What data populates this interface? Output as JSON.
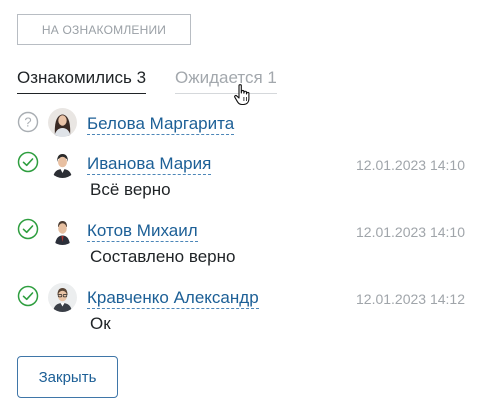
{
  "status_button": {
    "label": "НА ОЗНАКОМЛЕНИИ"
  },
  "tabs": [
    {
      "label": "Ознакомились 3",
      "active": true
    },
    {
      "label": "Ожидается 1",
      "active": false
    }
  ],
  "pending": [
    {
      "name": "Белова Маргарита",
      "status_icon": "question-icon"
    }
  ],
  "acknowledged": [
    {
      "name": "Иванова Мария",
      "time": "12.01.2023 14:10",
      "comment": "Всё верно",
      "status_icon": "check-circle-icon"
    },
    {
      "name": "Котов Михаил",
      "time": "12.01.2023 14:10",
      "comment": "Составлено верно",
      "status_icon": "check-circle-icon"
    },
    {
      "name": "Кравченко Александр",
      "time": "12.01.2023 14:12",
      "comment": "Ок",
      "status_icon": "check-circle-icon"
    }
  ],
  "close_button": {
    "label": "Закрыть"
  },
  "colors": {
    "link": "#1c5f96",
    "success": "#2e9e3f",
    "muted": "#a0a5aa",
    "border": "#b8bdc3"
  }
}
